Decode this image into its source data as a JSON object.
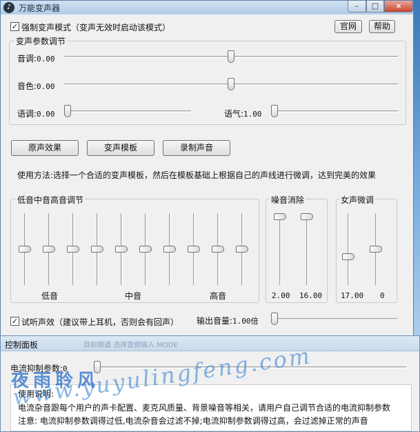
{
  "window": {
    "title": "万能变声器",
    "app_icon": "audio-app-icon",
    "min_label": "–",
    "max_label": "□",
    "close_label": "×"
  },
  "force_mode": {
    "label": "强制变声模式（变声无效时启动该模式）",
    "checked": true
  },
  "top_buttons": {
    "website": "官网",
    "help": "帮助"
  },
  "params": {
    "group_title": "变声参数调节",
    "pitch": {
      "label": "音调:",
      "value": "0.00",
      "level": 0.5
    },
    "timbre": {
      "label": "音色:",
      "value": "0.00",
      "level": 0.5
    },
    "speed": {
      "label": "语调:",
      "value": "0.00",
      "level": 0.0
    },
    "tone": {
      "label": "语气:",
      "value": "1.00",
      "level": 0.0
    }
  },
  "actions": {
    "original": "原声效果",
    "templates": "变声模板",
    "record": "录制声音"
  },
  "hint": "使用方法:选择一个合适的变声模板，然后在模板基础上根据自己的声线进行微调，达到完美的效果",
  "eq": {
    "group_title": "低音中音高音调节",
    "bands": [
      0.5,
      0.5,
      0.5,
      0.5,
      0.5,
      0.5,
      0.5,
      0.5,
      0.5,
      0.5
    ],
    "labels": {
      "low": "低音",
      "mid": "中音",
      "high": "高音"
    }
  },
  "noise": {
    "group_title": "噪音消除",
    "slider1": {
      "value": "2.00",
      "level": 0.0
    },
    "slider2": {
      "value": "16.00",
      "level": 0.0
    }
  },
  "female": {
    "group_title": "女声微调",
    "slider1": {
      "value": "17.00",
      "level": 0.62
    },
    "slider2": {
      "value": "0",
      "level": 0.5
    }
  },
  "monitor": {
    "label": "试听声效（建议带上耳机，否则会有回声）",
    "checked": true
  },
  "output_volume": {
    "label": "输出音量:",
    "value": "1.00倍",
    "level": 0.0
  },
  "control_panel": {
    "title": "控制面板",
    "faded_title": "目标频道 选择音频输入 MODE",
    "current_suppression": {
      "label": "电流抑制参数:",
      "value": "0",
      "level": 0.0
    },
    "usage_title": "使用说明:",
    "usage_line1": "电流杂音跟每个用户的声卡配置、麦克风质量、背景噪音等相关，请用户自己调节合适的电流抑制参数",
    "usage_line2": "注意: 电流抑制参数调得过低,电流杂音会过滤不掉;电流抑制参数调得过高，会过滤掉正常的声音"
  },
  "watermark": {
    "chinese": "夜雨聆风",
    "url": "www.yuyulingfeng.com"
  }
}
